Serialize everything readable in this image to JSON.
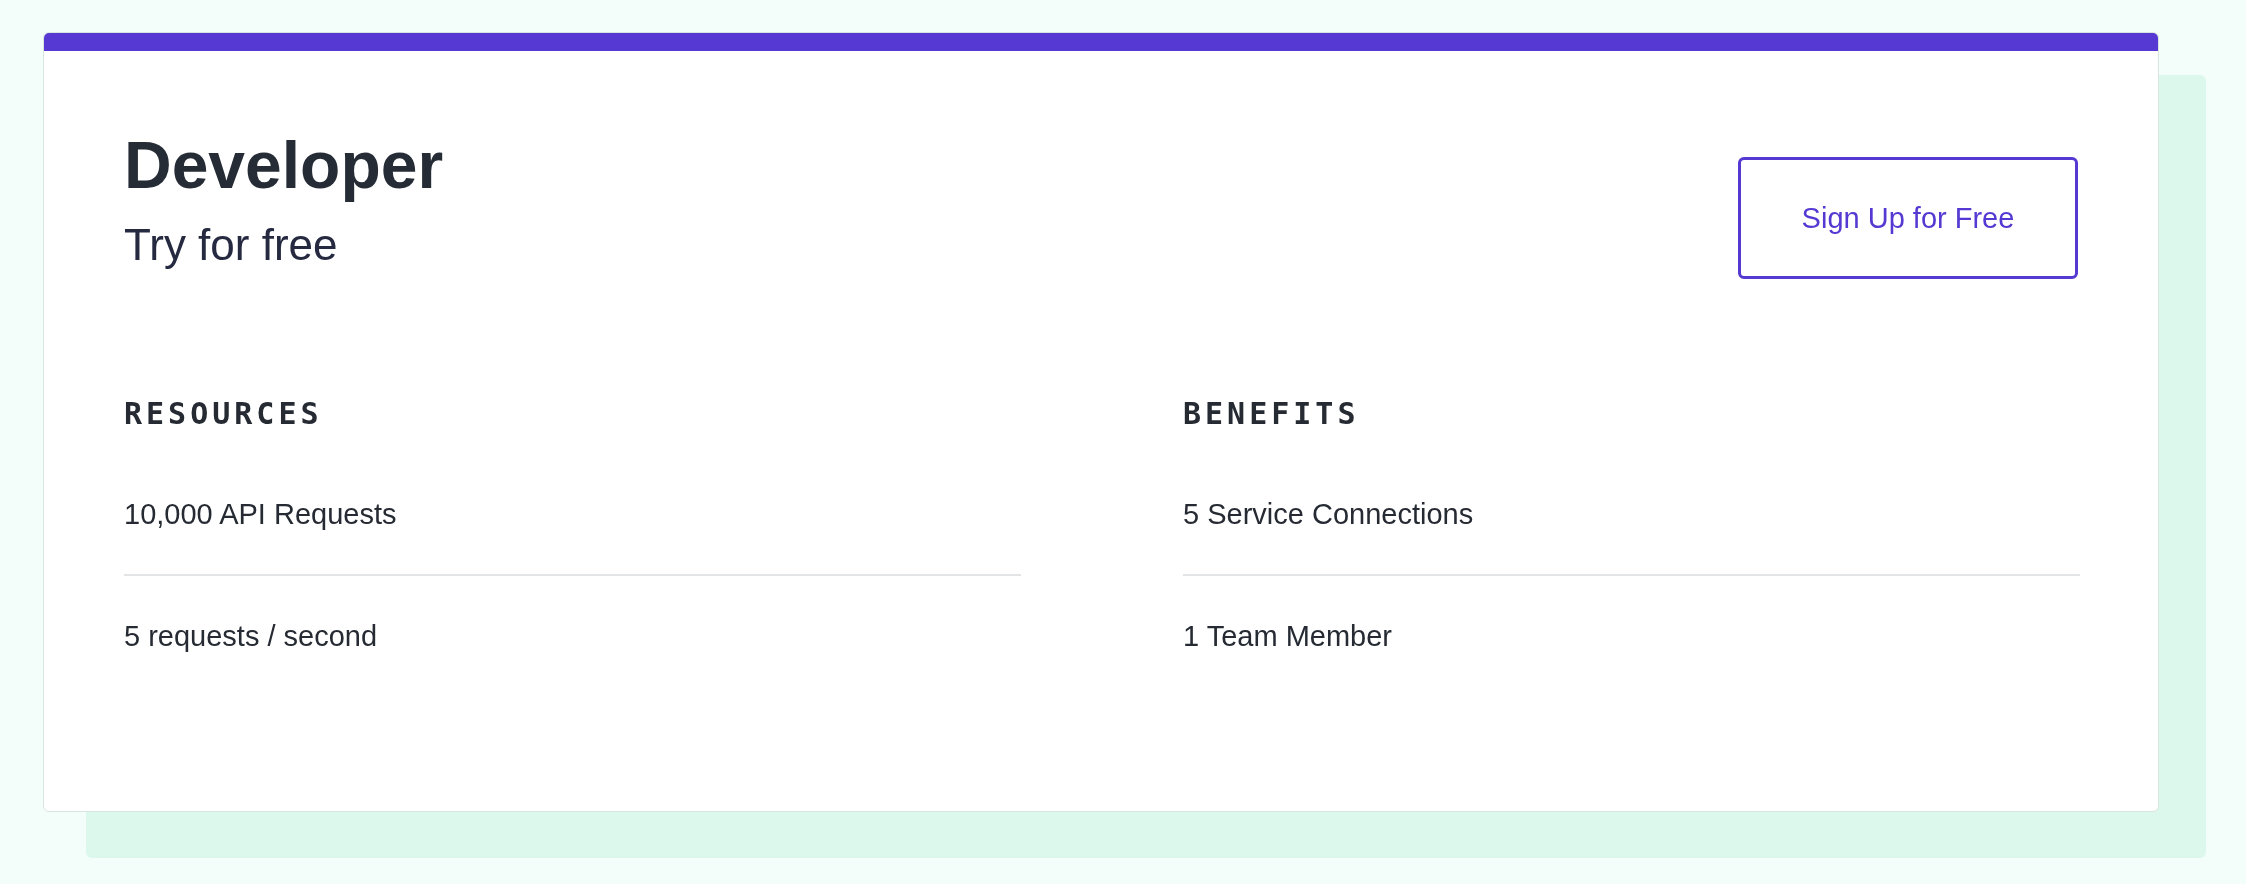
{
  "plan": {
    "title": "Developer",
    "subtitle": "Try for free",
    "button": "Sign Up for Free"
  },
  "sections": [
    {
      "heading": "RESOURCES",
      "items": [
        "10,000 API Requests",
        "5 requests / second"
      ]
    },
    {
      "heading": "BENEFITS",
      "items": [
        "5 Service Connections",
        "1 Team Member"
      ]
    }
  ]
}
